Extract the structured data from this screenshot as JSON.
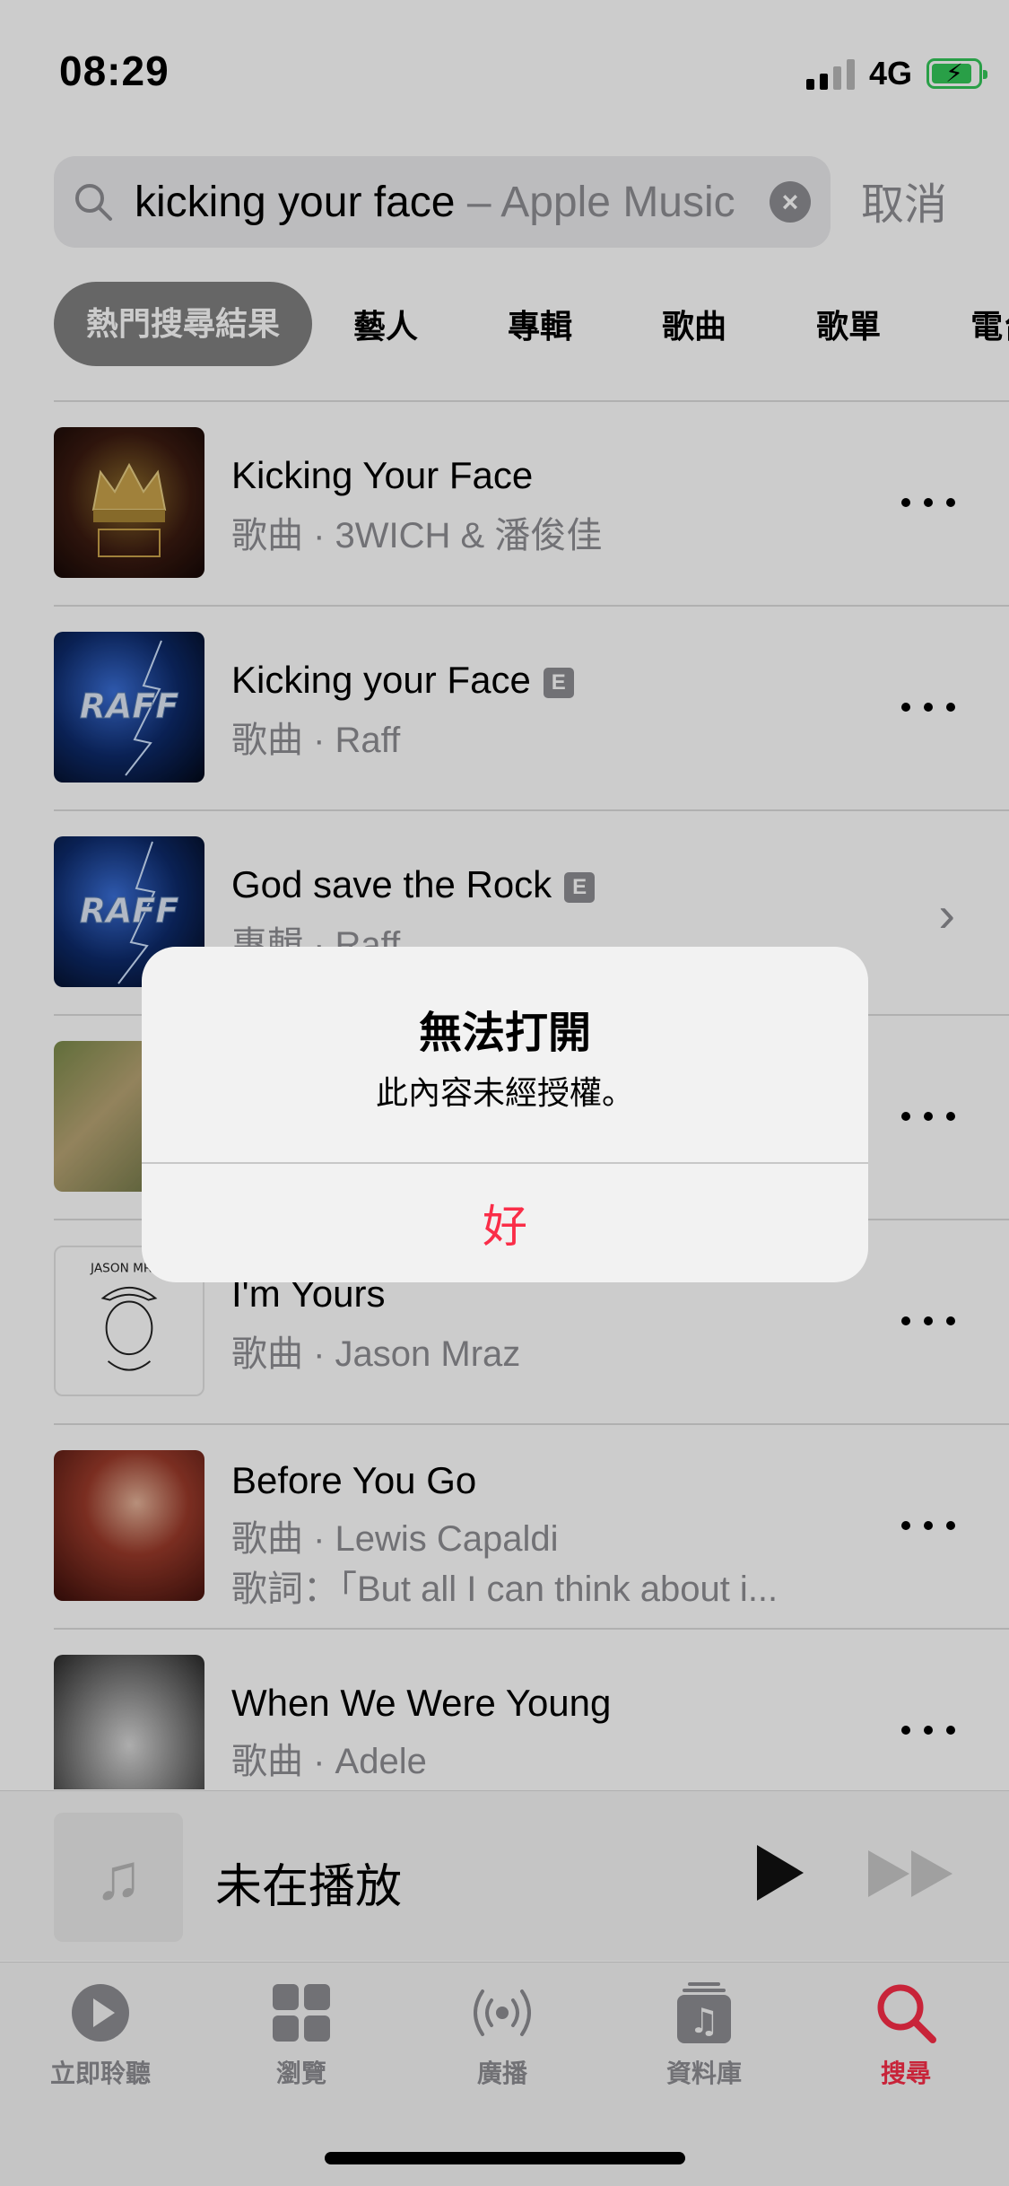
{
  "status_bar": {
    "time": "08:29",
    "network": "4G",
    "battery_charging": true
  },
  "search": {
    "query": "kicking your face",
    "suggestion_suffix": " – Apple Music",
    "cancel_label": "取消"
  },
  "filter_tabs": [
    {
      "label": "熱門搜尋結果",
      "active": true
    },
    {
      "label": "藝人",
      "active": false
    },
    {
      "label": "專輯",
      "active": false
    },
    {
      "label": "歌曲",
      "active": false
    },
    {
      "label": "歌單",
      "active": false
    },
    {
      "label": "電台",
      "active": false
    }
  ],
  "results": [
    {
      "title": "Kicking Your Face",
      "subtitle": "歌曲 · 3WICH & 潘俊佳",
      "explicit": false,
      "action": "more-icon"
    },
    {
      "title": "Kicking your Face",
      "subtitle": "歌曲 · Raff",
      "explicit": true,
      "action": "more-icon"
    },
    {
      "title": "God save the Rock",
      "subtitle": "專輯 · Raff",
      "explicit": true,
      "action": "chevron-right-icon"
    },
    {
      "title": "",
      "subtitle": "",
      "explicit": false,
      "action": "more-icon"
    },
    {
      "title": "I'm Yours",
      "subtitle": "歌曲 · Jason Mraz",
      "explicit": false,
      "action": "more-icon"
    },
    {
      "title": "Before You Go",
      "subtitle": "歌曲 · Lewis Capaldi",
      "lyrics": "歌詞：「But all I can think about i...",
      "explicit": false,
      "action": "more-icon"
    },
    {
      "title": "When We Were Young",
      "subtitle": "歌曲 · Adele",
      "explicit": false,
      "action": "more-icon"
    }
  ],
  "artwork_text": {
    "raff": "RAFF",
    "jason": "JASON MR"
  },
  "explicit_badge": "E",
  "mini_player": {
    "title": "未在播放"
  },
  "tab_bar": [
    {
      "label": "立即聆聽",
      "icon": "play-circle-icon",
      "active": false
    },
    {
      "label": "瀏覽",
      "icon": "grid-icon",
      "active": false
    },
    {
      "label": "廣播",
      "icon": "radio-icon",
      "active": false
    },
    {
      "label": "資料庫",
      "icon": "library-icon",
      "active": false
    },
    {
      "label": "搜尋",
      "icon": "search-icon",
      "active": true
    }
  ],
  "alert": {
    "title": "無法打開",
    "message": "此內容未經授權。",
    "button": "好"
  },
  "colors": {
    "accent": "#fa2d48",
    "secondary_text": "#8e8e93",
    "tab_active_bg": "#808080",
    "battery": "#34c759"
  }
}
